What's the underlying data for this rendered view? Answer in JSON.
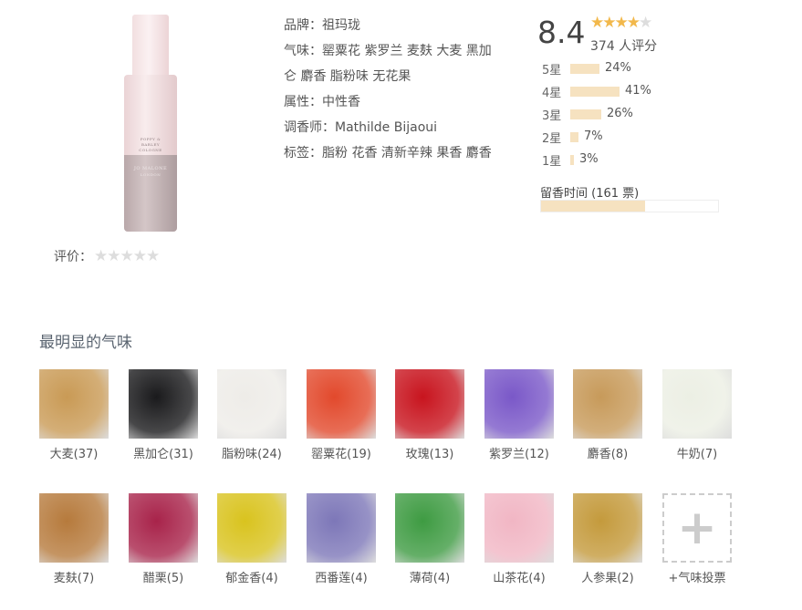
{
  "product": {
    "bottle_label_top": [
      "POPPY &",
      "BARLEY",
      "COLOGNE"
    ],
    "bottle_label_brand": "JO MALONE",
    "bottle_label_city": "LONDON",
    "user_rating_label": "评价：",
    "user_rating_stars": "★★★★★"
  },
  "info": {
    "brand_label": "品牌：",
    "brand": "祖玛珑",
    "notes_label": "气味：",
    "notes_line1": "罂粟花 紫罗兰 麦麸 大麦 黑加",
    "notes_line2": "仑 麝香 脂粉味 无花果",
    "attr_label": "属性：",
    "attr": "中性香",
    "perfumer_label": "调香师：",
    "perfumer": "Mathilde Bijaoui",
    "tags_label": "标签：",
    "tags": "脂粉 花香 清新辛辣 果香 麝香"
  },
  "score": {
    "value": "8.4",
    "stars_filled": 4,
    "stars_total": 5,
    "count_text": "374 人评分",
    "distribution": [
      {
        "label": "5星",
        "pct_text": "24%",
        "pct": 24
      },
      {
        "label": "4星",
        "pct_text": "41%",
        "pct": 41
      },
      {
        "label": "3星",
        "pct_text": "26%",
        "pct": 26
      },
      {
        "label": "2星",
        "pct_text": "7%",
        "pct": 7
      },
      {
        "label": "1星",
        "pct_text": "3%",
        "pct": 3
      }
    ],
    "longevity_text": "留香时间 (161 票)",
    "longevity_fill": 0.59
  },
  "scents": {
    "title": "最明显的气味",
    "items": [
      {
        "label": "大麦(37)",
        "color": "#c99a55",
        "icon": "barley-photo"
      },
      {
        "label": "黑加仑(31)",
        "color": "#1a1a1c",
        "icon": "blackcurrant-photo"
      },
      {
        "label": "脂粉味(24)",
        "color": "#eeece8",
        "icon": "powder-photo"
      },
      {
        "label": "罂粟花(19)",
        "color": "#e2492c",
        "icon": "poppy-photo"
      },
      {
        "label": "玫瑰(13)",
        "color": "#c8141e",
        "icon": "rose-photo"
      },
      {
        "label": "紫罗兰(12)",
        "color": "#7a58c8",
        "icon": "violet-photo"
      },
      {
        "label": "麝香(8)",
        "color": "#c79a5a",
        "icon": "musk-deer-photo"
      },
      {
        "label": "牛奶(7)",
        "color": "#ecefe4",
        "icon": "milk-photo"
      },
      {
        "label": "麦麸(7)",
        "color": "#b67a3c",
        "icon": "bran-photo"
      },
      {
        "label": "醋栗(5)",
        "color": "#a8234a",
        "icon": "gooseberry-photo"
      },
      {
        "label": "郁金香(4)",
        "color": "#d9c31e",
        "icon": "tulip-photo"
      },
      {
        "label": "西番莲(4)",
        "color": "#7d77b8",
        "icon": "passionflower-photo"
      },
      {
        "label": "薄荷(4)",
        "color": "#3e9b42",
        "icon": "mint-photo"
      },
      {
        "label": "山茶花(4)",
        "color": "#f1b6c4",
        "icon": "camellia-photo"
      },
      {
        "label": "人参果(2)",
        "color": "#c49a3c",
        "icon": "sapodilla-photo"
      }
    ],
    "add_label": "+气味投票"
  }
}
